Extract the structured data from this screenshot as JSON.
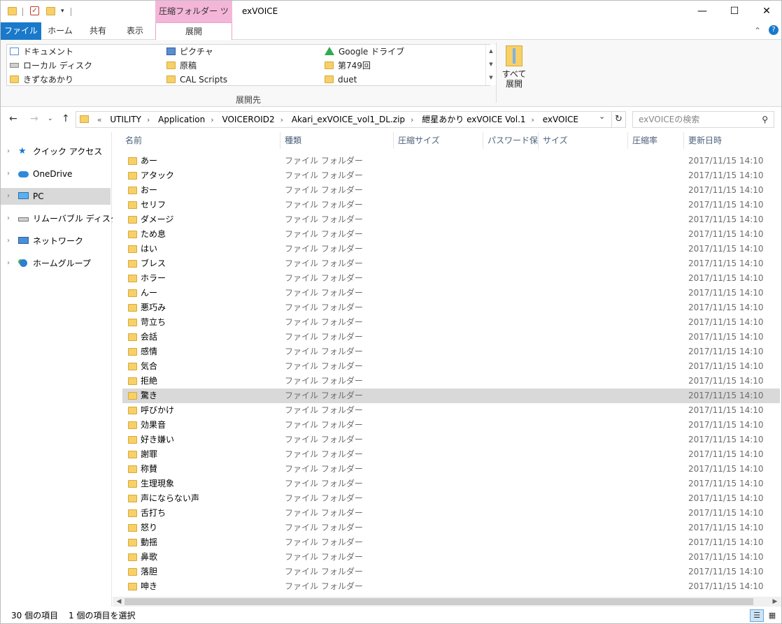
{
  "title_bar": {
    "context_tab": "圧縮フォルダー ツール",
    "window_title": "exVOICE",
    "minimize_icon": "minimize-icon",
    "maximize_icon": "maximize-icon",
    "close_icon": "close-icon"
  },
  "ribbon_tabs": [
    {
      "label": "ファイル"
    },
    {
      "label": "ホーム"
    },
    {
      "label": "共有"
    },
    {
      "label": "表示"
    },
    {
      "label": "展開"
    }
  ],
  "ribbon": {
    "destinations": [
      {
        "label": "ドキュメント",
        "icon": "document-icon"
      },
      {
        "label": "ピクチャ",
        "icon": "pictures-icon"
      },
      {
        "label": "Google ドライブ",
        "icon": "google-drive-icon"
      },
      {
        "label": "ローカル ディスク",
        "icon": "drive-icon"
      },
      {
        "label": "原稿",
        "icon": "folder-icon"
      },
      {
        "label": "第749回",
        "icon": "folder-icon"
      },
      {
        "label": "きずなあかり",
        "icon": "folder-icon"
      },
      {
        "label": "CAL Scripts",
        "icon": "folder-icon"
      },
      {
        "label": "duet",
        "icon": "folder-icon"
      }
    ],
    "group_label": "展開先",
    "extract_all_label_1": "すべて",
    "extract_all_label_2": "展開"
  },
  "address": {
    "overflow": "«",
    "segments": [
      "UTILITY",
      "Application",
      "VOICEROID2",
      "Akari_exVOICE_vol1_DL.zip",
      "紲星あかり exVOICE Vol.1",
      "exVOICE"
    ],
    "search_placeholder": "exVOICEの検索"
  },
  "nav_pane": [
    {
      "label": "クイック アクセス",
      "icon": "star-icon",
      "selected": false
    },
    {
      "label": "OneDrive",
      "icon": "onedrive-icon",
      "selected": false
    },
    {
      "label": "PC",
      "icon": "pc-icon",
      "selected": true
    },
    {
      "label": "リムーバブル ディスク (E:)",
      "icon": "removable-drive-icon",
      "selected": false
    },
    {
      "label": "ネットワーク",
      "icon": "network-icon",
      "selected": false
    },
    {
      "label": "ホームグループ",
      "icon": "homegroup-icon",
      "selected": false
    }
  ],
  "columns": [
    "名前",
    "種類",
    "圧縮サイズ",
    "パスワード保...",
    "サイズ",
    "圧縮率",
    "更新日時"
  ],
  "files": [
    {
      "name": "あー",
      "type": "ファイル フォルダー",
      "date": "2017/11/15 14:10"
    },
    {
      "name": "アタック",
      "type": "ファイル フォルダー",
      "date": "2017/11/15 14:10"
    },
    {
      "name": "おー",
      "type": "ファイル フォルダー",
      "date": "2017/11/15 14:10"
    },
    {
      "name": "セリフ",
      "type": "ファイル フォルダー",
      "date": "2017/11/15 14:10"
    },
    {
      "name": "ダメージ",
      "type": "ファイル フォルダー",
      "date": "2017/11/15 14:10"
    },
    {
      "name": "ため息",
      "type": "ファイル フォルダー",
      "date": "2017/11/15 14:10"
    },
    {
      "name": "はい",
      "type": "ファイル フォルダー",
      "date": "2017/11/15 14:10"
    },
    {
      "name": "ブレス",
      "type": "ファイル フォルダー",
      "date": "2017/11/15 14:10"
    },
    {
      "name": "ホラー",
      "type": "ファイル フォルダー",
      "date": "2017/11/15 14:10"
    },
    {
      "name": "んー",
      "type": "ファイル フォルダー",
      "date": "2017/11/15 14:10"
    },
    {
      "name": "悪巧み",
      "type": "ファイル フォルダー",
      "date": "2017/11/15 14:10"
    },
    {
      "name": "苛立ち",
      "type": "ファイル フォルダー",
      "date": "2017/11/15 14:10"
    },
    {
      "name": "会話",
      "type": "ファイル フォルダー",
      "date": "2017/11/15 14:10"
    },
    {
      "name": "感情",
      "type": "ファイル フォルダー",
      "date": "2017/11/15 14:10"
    },
    {
      "name": "気合",
      "type": "ファイル フォルダー",
      "date": "2017/11/15 14:10"
    },
    {
      "name": "拒絶",
      "type": "ファイル フォルダー",
      "date": "2017/11/15 14:10"
    },
    {
      "name": "驚き",
      "type": "ファイル フォルダー",
      "date": "2017/11/15 14:10",
      "selected": true
    },
    {
      "name": "呼びかけ",
      "type": "ファイル フォルダー",
      "date": "2017/11/15 14:10"
    },
    {
      "name": "効果音",
      "type": "ファイル フォルダー",
      "date": "2017/11/15 14:10"
    },
    {
      "name": "好き嫌い",
      "type": "ファイル フォルダー",
      "date": "2017/11/15 14:10"
    },
    {
      "name": "謝罪",
      "type": "ファイル フォルダー",
      "date": "2017/11/15 14:10"
    },
    {
      "name": "称賛",
      "type": "ファイル フォルダー",
      "date": "2017/11/15 14:10"
    },
    {
      "name": "生理現象",
      "type": "ファイル フォルダー",
      "date": "2017/11/15 14:10"
    },
    {
      "name": "声にならない声",
      "type": "ファイル フォルダー",
      "date": "2017/11/15 14:10"
    },
    {
      "name": "舌打ち",
      "type": "ファイル フォルダー",
      "date": "2017/11/15 14:10"
    },
    {
      "name": "怒り",
      "type": "ファイル フォルダー",
      "date": "2017/11/15 14:10"
    },
    {
      "name": "動揺",
      "type": "ファイル フォルダー",
      "date": "2017/11/15 14:10"
    },
    {
      "name": "鼻歌",
      "type": "ファイル フォルダー",
      "date": "2017/11/15 14:10"
    },
    {
      "name": "落胆",
      "type": "ファイル フォルダー",
      "date": "2017/11/15 14:10"
    },
    {
      "name": "呻き",
      "type": "ファイル フォルダー",
      "date": "2017/11/15 14:10"
    }
  ],
  "status": {
    "item_count": "30 個の項目",
    "selection": "1 個の項目を選択"
  },
  "colors": {
    "accent": "#1979ca",
    "context_tab": "#f4b6d8",
    "folder": "#f7d068",
    "selected_row": "#d9d9d9"
  }
}
